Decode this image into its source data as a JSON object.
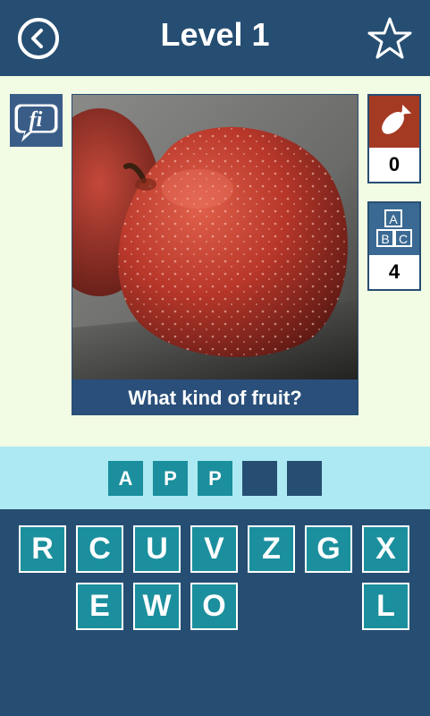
{
  "header": {
    "title": "Level 1",
    "back_icon": "back-arrow-icon",
    "favorite_icon": "star-icon"
  },
  "logo": {
    "text": "fi",
    "icon": "fi-logo-icon"
  },
  "puzzle": {
    "image_icon": "apple-photo",
    "question": "What kind of fruit?"
  },
  "hints": {
    "bomb": {
      "icon": "bomb-icon",
      "count": "0"
    },
    "reveal": {
      "icon": "abc-blocks-icon",
      "count": "4"
    }
  },
  "answer": {
    "slots": [
      "A",
      "P",
      "P",
      "",
      ""
    ]
  },
  "keyboard": {
    "row1": [
      "R",
      "C",
      "U",
      "V",
      "Z",
      "G",
      "X"
    ],
    "row2": [
      "E",
      "W",
      "O",
      "",
      "",
      "",
      "L"
    ]
  },
  "colors": {
    "header_bg": "#264e72",
    "play_bg": "#f2fbe4",
    "strip_bg": "#ace9f2",
    "key_bg": "#1b8f9d",
    "bomb_bg": "#a53a22"
  }
}
